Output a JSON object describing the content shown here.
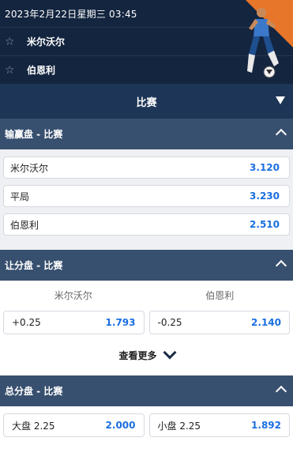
{
  "match": {
    "datetime": "2023年2月22日星期三 03:45",
    "teams": [
      {
        "name": "米尔沃尔"
      },
      {
        "name": "伯恩利"
      }
    ]
  },
  "match_bar": {
    "title": "比赛"
  },
  "moneyline": {
    "title": "输赢盘 - 比赛",
    "rows": [
      {
        "label": "米尔沃尔",
        "odds": "3.120"
      },
      {
        "label": "平局",
        "odds": "3.230"
      },
      {
        "label": "伯恩利",
        "odds": "2.510"
      }
    ]
  },
  "handicap": {
    "title": "让分盘 - 比赛",
    "home_label": "米尔沃尔",
    "away_label": "伯恩利",
    "rows": [
      {
        "home_line": "+0.25",
        "home_odds": "1.793",
        "away_line": "-0.25",
        "away_odds": "2.140"
      }
    ],
    "more_label": "查看更多"
  },
  "totals": {
    "title": "总分盘 - 比赛",
    "rows": [
      {
        "over_label": "大盘 2.25",
        "over_odds": "2.000",
        "under_label": "小盘 2.25",
        "under_odds": "1.892"
      }
    ]
  },
  "colors": {
    "header_bg": "#14253f",
    "section_bg": "#38506f",
    "odds_blue": "#1a6fe0",
    "accent_orange": "#e8762a"
  }
}
